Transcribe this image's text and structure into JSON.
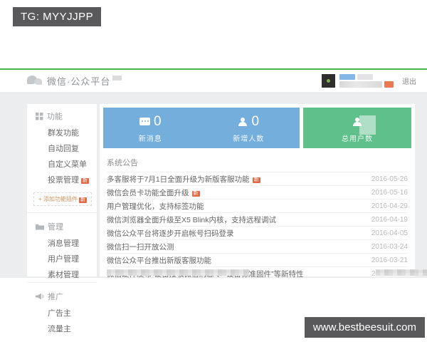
{
  "overlay": {
    "tg_label": "TG: MYYJJPP",
    "watermark": "www.bestbeesuit.com"
  },
  "header": {
    "brand": "微信·公众平台",
    "logout_label": "退出"
  },
  "stats": {
    "new_message": {
      "value": "0",
      "label": "新消息"
    },
    "new_followers": {
      "value": "0",
      "label": "新增人数"
    },
    "total_users": {
      "label": "总用户数"
    }
  },
  "sidebar": {
    "sections": [
      {
        "title": "功能"
      },
      {
        "title": "管理"
      },
      {
        "title": "推广"
      }
    ],
    "function_items": [
      "群发功能",
      "自动回复",
      "自定义菜单",
      "投票管理"
    ],
    "manage_items": [
      "消息管理",
      "用户管理",
      "素材管理"
    ],
    "promo_items": [
      "广告主",
      "流量主"
    ],
    "add_plugin_label": "+ 添加功能插件",
    "new_badge": "新"
  },
  "announcements": {
    "title": "系统公告",
    "items": [
      {
        "text": "多客服将于7月1日全面升级为新版客服功能",
        "date": "2016-05-26",
        "badge": "新"
      },
      {
        "text": "微信会员卡功能全面升级",
        "date": "2016-05-16",
        "badge": "新"
      },
      {
        "text": "用户管理优化，支持标签功能",
        "date": "2016-04-29"
      },
      {
        "text": "微信浏览器全面升级至X5 Blink内核，支持远程调试",
        "date": "2016-04-19"
      },
      {
        "text": "微信公众平台将逐步开启帐号扫码登录",
        "date": "2016-04-05"
      },
      {
        "text": "微信扫一扫开放公测",
        "date": "2016-03-24"
      },
      {
        "text": "微信公众平台推出新版客服功能",
        "date": "2016-03-21"
      },
      {
        "text": "微信硬件发布“设备接收微信消息”、“设备标准固件”等新特性",
        "date": "2016-03-21"
      }
    ]
  },
  "colors": {
    "accent_green_line": "#44b549",
    "card_blue": "#74aedd",
    "card_green": "#5fc08c",
    "badge_orange": "#df6a45"
  }
}
